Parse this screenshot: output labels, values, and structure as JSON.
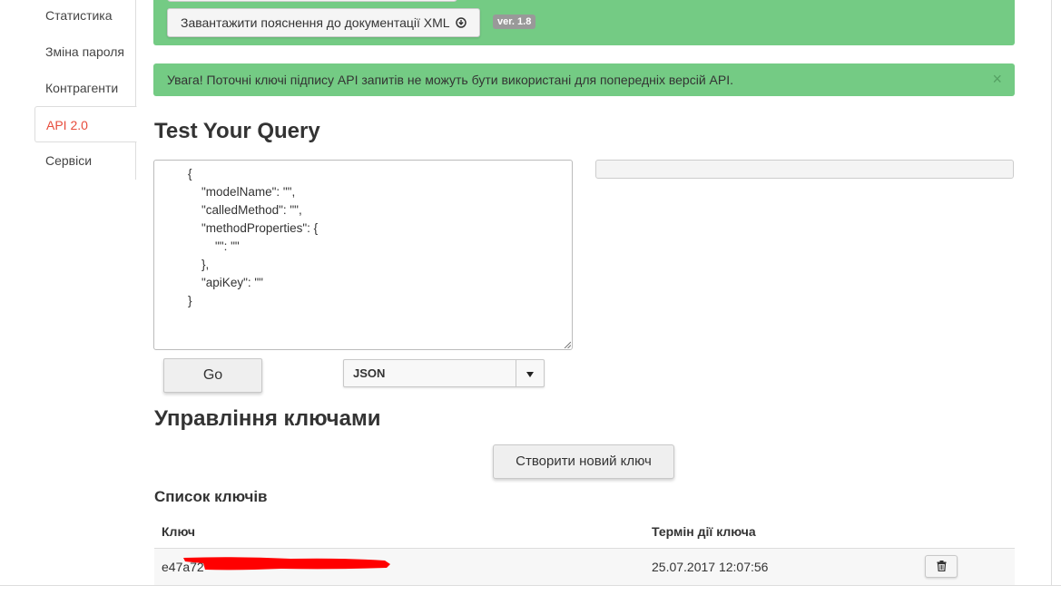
{
  "sidebar": {
    "items": [
      {
        "label": "Статистика",
        "active": false
      },
      {
        "label": "Зміна пароля",
        "active": false
      },
      {
        "label": "Контрагенти",
        "active": false
      },
      {
        "label": "API 2.0",
        "active": true
      },
      {
        "label": "Сервіси",
        "active": false
      }
    ]
  },
  "top_panel": {
    "download_button_label": "Завантажити пояснення до документації XML",
    "download_icon": "download-circle-icon",
    "version_badge": "ver. 1.8"
  },
  "alert": {
    "text": "Увага! Поточні ключі підпису API запитів не можуть бути використані для попередніх версій API.",
    "close_symbol": "×"
  },
  "test_query": {
    "heading": "Test Your Query",
    "query_text": "{\n    \"modelName\": \"\",\n    \"calledMethod\": \"\",\n    \"methodProperties\": {\n        \"\": \"\"\n    },\n    \"apiKey\": \"\"\n}",
    "go_label": "Go",
    "format_selected": "JSON",
    "result_value": ""
  },
  "keys": {
    "heading": "Управління ключами",
    "create_button_label": "Створити новий ключ",
    "list_title": "Список ключів",
    "columns": [
      "Ключ",
      "Термін дії ключа"
    ],
    "rows": [
      {
        "key": "e47a72",
        "term": "25.07.2017 12:07:56",
        "redacted": true
      }
    ]
  },
  "colors": {
    "panel_green": "#74cb84",
    "active_link": "#e74c3c",
    "redaction": "#ff0000"
  }
}
